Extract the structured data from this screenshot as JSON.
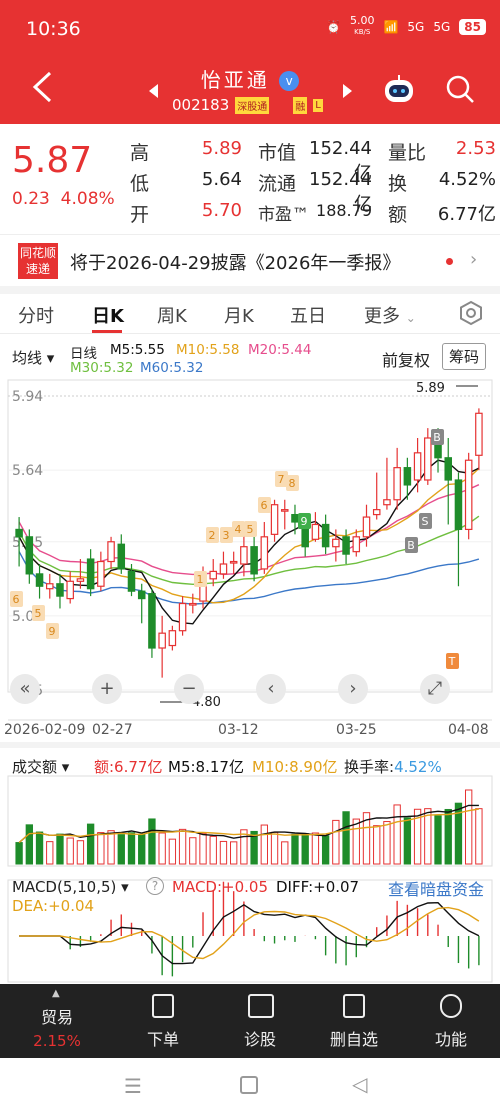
{
  "status": {
    "time": "10:36",
    "speed_value": "5.00",
    "speed_unit": "KB/S",
    "signal1": "5G",
    "signal2": "5G",
    "battery": "85"
  },
  "header": {
    "name": "怡亚通",
    "code": "002183",
    "tag1": "深股通",
    "tag2": "融",
    "tag3": "L",
    "verified_icon": "v"
  },
  "quote": {
    "price": "5.87",
    "change": "0.23",
    "change_pct": "4.08%",
    "rows": [
      {
        "l1": "高",
        "v1": "5.89",
        "l2": "市值",
        "v2": "152.44亿",
        "l3": "量比",
        "v3": "2.53"
      },
      {
        "l1": "低",
        "v1": "5.64",
        "l2": "流通",
        "v2": "152.44亿",
        "l3": "换",
        "v3": "4.52%"
      },
      {
        "l1": "开",
        "v1": "5.70",
        "l2": "市盈™",
        "v2": "188.79",
        "l3": "额",
        "v3": "6.77亿"
      }
    ]
  },
  "notice": {
    "logo_line1": "同花顺",
    "logo_line2": "速递",
    "text": "将于2026-04-29披露《2026年一季报》",
    "chevron": "›"
  },
  "tabs": [
    {
      "label": "分时"
    },
    {
      "label": "日K"
    },
    {
      "label": "周K"
    },
    {
      "label": "月K"
    },
    {
      "label": "五日"
    },
    {
      "label": "更多"
    }
  ],
  "tabs_more_chevron": "⌄",
  "chart_header": {
    "indicator": "均线",
    "period": "日线",
    "ma5": "M5:5.55",
    "ma10": "M10:5.58",
    "ma20": "M20:5.44",
    "ma30": "M30:5.32",
    "ma60": "M60:5.32",
    "fuquan": "前复权",
    "chouma": "筹码"
  },
  "colors": {
    "up": "#e63232",
    "down": "#1e8c2a",
    "ma5": "#111111",
    "ma10": "#e2a21a",
    "ma20": "#e64d8c",
    "ma30": "#6fbf3f",
    "ma60": "#3b78c8"
  },
  "chart_data": {
    "type": "candlestick",
    "y_ticks": [
      "5.94",
      "5.64",
      "5.35",
      "5.05",
      "4.75"
    ],
    "x_ticks": [
      "2026-02-09",
      "02-27",
      "03-12",
      "03-25",
      "04-08"
    ],
    "ylim": [
      4.75,
      5.94
    ],
    "high_label": "5.89",
    "low_label": "4.80",
    "signal_marks": [
      "6",
      "5",
      "9",
      "1",
      "2",
      "3",
      "4",
      "5",
      "6",
      "7",
      "8",
      "9",
      "B",
      "B",
      "S",
      "T"
    ],
    "candles": [
      [
        5.4,
        5.37,
        5.45,
        5.25
      ],
      [
        5.37,
        5.22,
        5.4,
        5.18
      ],
      [
        5.22,
        5.17,
        5.26,
        5.12
      ],
      [
        5.16,
        5.18,
        5.22,
        5.12
      ],
      [
        5.18,
        5.13,
        5.22,
        5.08
      ],
      [
        5.12,
        5.19,
        5.23,
        5.1
      ],
      [
        5.19,
        5.2,
        5.28,
        5.16
      ],
      [
        5.28,
        5.16,
        5.32,
        5.13
      ],
      [
        5.17,
        5.27,
        5.31,
        5.15
      ],
      [
        5.27,
        5.35,
        5.37,
        5.24
      ],
      [
        5.34,
        5.24,
        5.38,
        5.22
      ],
      [
        5.23,
        5.15,
        5.26,
        5.13
      ],
      [
        5.15,
        5.12,
        5.18,
        5.02
      ],
      [
        5.14,
        4.92,
        5.16,
        4.88
      ],
      [
        4.92,
        4.98,
        5.05,
        4.8
      ],
      [
        4.93,
        4.99,
        5.01,
        4.91
      ],
      [
        4.99,
        5.1,
        5.13,
        4.97
      ],
      [
        5.1,
        5.1,
        5.14,
        5.06
      ],
      [
        5.11,
        5.2,
        5.25,
        5.08
      ],
      [
        5.2,
        5.23,
        5.28,
        5.17
      ],
      [
        5.22,
        5.26,
        5.31,
        5.2
      ],
      [
        5.27,
        5.27,
        5.31,
        5.22
      ],
      [
        5.26,
        5.33,
        5.4,
        5.21
      ],
      [
        5.33,
        5.22,
        5.38,
        5.19
      ],
      [
        5.24,
        5.37,
        5.43,
        5.22
      ],
      [
        5.38,
        5.5,
        5.52,
        5.35
      ],
      [
        5.48,
        5.48,
        5.52,
        5.4
      ],
      [
        5.46,
        5.43,
        5.5,
        5.38
      ],
      [
        5.42,
        5.33,
        5.46,
        5.29
      ],
      [
        5.36,
        5.42,
        5.47,
        5.35
      ],
      [
        5.42,
        5.33,
        5.46,
        5.3
      ],
      [
        5.33,
        5.36,
        5.4,
        5.27
      ],
      [
        5.37,
        5.3,
        5.4,
        5.26
      ],
      [
        5.31,
        5.37,
        5.4,
        5.29
      ],
      [
        5.37,
        5.45,
        5.5,
        5.33
      ],
      [
        5.46,
        5.48,
        5.63,
        5.44
      ],
      [
        5.5,
        5.52,
        5.69,
        5.48
      ],
      [
        5.52,
        5.65,
        5.73,
        5.48
      ],
      [
        5.65,
        5.58,
        5.69,
        5.52
      ],
      [
        5.6,
        5.71,
        5.77,
        5.55
      ],
      [
        5.6,
        5.77,
        5.81,
        5.58
      ],
      [
        5.76,
        5.69,
        5.81,
        5.63
      ],
      [
        5.69,
        5.6,
        5.77,
        5.42
      ],
      [
        5.6,
        5.4,
        5.63,
        5.17
      ],
      [
        5.4,
        5.68,
        5.71,
        5.36
      ],
      [
        5.7,
        5.87,
        5.89,
        5.64
      ]
    ]
  },
  "volume": {
    "label": "成交额",
    "e": "额:6.77亿",
    "m5": "M5:8.17亿",
    "m10": "M10:8.90亿",
    "turnover_label": "换手率:",
    "turnover": "4.52%"
  },
  "macd": {
    "label": "MACD(5,10,5)",
    "help": "?",
    "macd": "MACD:+0.05",
    "diff": "DIFF:+0.07",
    "dea": "DEA:+0.04",
    "link": "查看暗盘资金"
  },
  "bottom_nav": {
    "trade": "贸易",
    "trade_pct": "2.15%",
    "order": "下单",
    "diagnose": "诊股",
    "delete": "删自选",
    "func": "功能"
  }
}
